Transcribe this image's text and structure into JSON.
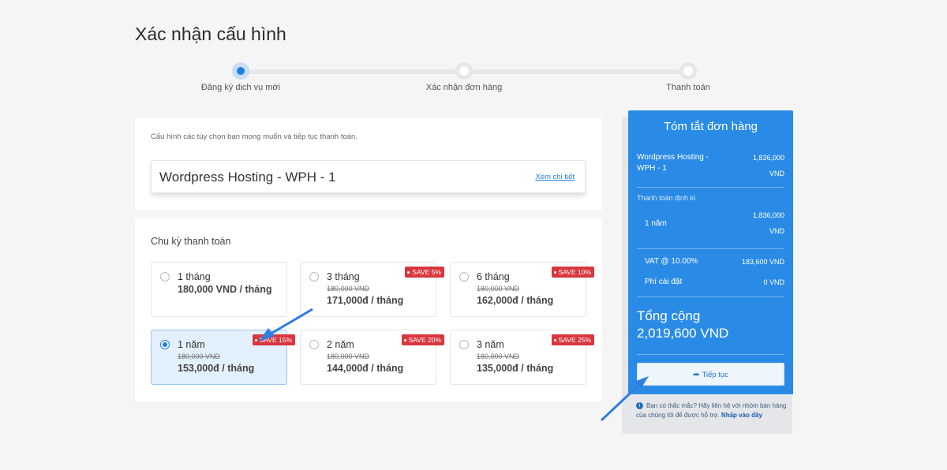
{
  "page": {
    "title": "Xác nhận cấu hình"
  },
  "stepper": {
    "steps": [
      {
        "label": "Đăng ký dịch vụ mới",
        "active": true
      },
      {
        "label": "Xác nhận đơn hàng",
        "active": false
      },
      {
        "label": "Thanh toán",
        "active": false
      }
    ]
  },
  "config": {
    "intro": "Cấu hình các tùy chọn bạn mong muốn và tiếp tục thanh toán.",
    "product_name": "Wordpress Hosting - WPH - 1",
    "detail_link": "Xem chi tiết"
  },
  "billing": {
    "title": "Chu kỳ thanh toán",
    "options": [
      {
        "period": "1 tháng",
        "old_price": "",
        "price": "180,000 VND / tháng",
        "badge": "",
        "selected": false
      },
      {
        "period": "3 tháng",
        "old_price": "180,000 VND",
        "price": "171,000đ / tháng",
        "badge": "SAVE 5%",
        "selected": false
      },
      {
        "period": "6 tháng",
        "old_price": "180,000 VND",
        "price": "162,000đ / tháng",
        "badge": "SAVE 10%",
        "selected": false
      },
      {
        "period": "1 năm",
        "old_price": "180,000 VND",
        "price": "153,000đ / tháng",
        "badge": "SAVE 15%",
        "selected": true
      },
      {
        "period": "2 năm",
        "old_price": "180,000 VND",
        "price": "144,000đ / tháng",
        "badge": "SAVE 20%",
        "selected": false
      },
      {
        "period": "3 năm",
        "old_price": "180,000 VND",
        "price": "135,000đ / tháng",
        "badge": "SAVE 25%",
        "selected": false
      }
    ]
  },
  "summary": {
    "title": "Tóm tắt đơn hàng",
    "item_name": "Wordpress Hosting - WPH - 1",
    "item_price_amount": "1,836,000",
    "item_price_currency": "VND",
    "cycle_label": "Thanh toán định kì",
    "cycle_value": "1 năm",
    "cycle_price_amount": "1,836,000",
    "cycle_price_currency": "VND",
    "vat_label": "VAT @ 10.00%",
    "vat_value": "183,600 VND",
    "setup_label": "Phí cài đặt",
    "setup_value": "0 VND",
    "total_label": "Tổng cộng",
    "total_value": "2,019,600 VND",
    "continue_label": "Tiếp tục"
  },
  "help": {
    "text": "Bạn có thắc mắc? Hãy liên hệ với nhóm bán hàng của chúng tôi để được hỗ trợ.",
    "link": "Nhấp vào đây"
  },
  "colors": {
    "accent": "#1f7fe0",
    "summary_bg": "#2a8be6",
    "badge": "#d9363e",
    "selected_bg": "#e3f0fd"
  }
}
